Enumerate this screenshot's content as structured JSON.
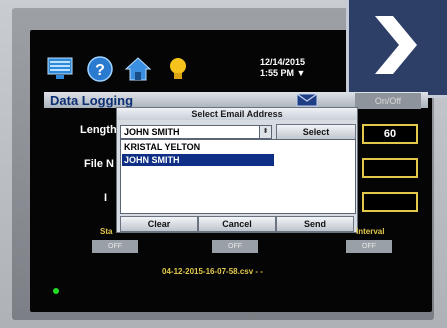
{
  "header": {
    "date": "12/14/2015",
    "time": "1:55 PM ▼"
  },
  "icons": [
    "monitor-icon",
    "help-icon",
    "home-icon",
    "lightbulb-icon",
    "email-icon",
    "chevron-right-icon"
  ],
  "page": {
    "title": "Data Logging",
    "onoff_label": "On/Off"
  },
  "fields": {
    "length_label": "Length (",
    "length_value": "60",
    "file_label": "File N",
    "i_label": "I"
  },
  "dialog": {
    "title": "Select Email Address",
    "combo_value": "JOHN SMITH",
    "select_label": "Select",
    "list": [
      "KRISTAL YELTON",
      "JOHN SMITH"
    ],
    "selected_index": 1,
    "buttons": {
      "clear": "Clear",
      "cancel": "Cancel",
      "send": "Send"
    }
  },
  "bottom": {
    "start_label": "Sta",
    "interval_label": "Interval",
    "toggles": [
      "OFF",
      "OFF",
      "OFF"
    ],
    "filename": "04-12-2015-16-07-58.csv - -"
  },
  "colors": {
    "accent": "#e2c94c",
    "title_blue": "#0c2f73",
    "selection": "#0f2f86",
    "badge": "#2e3f67"
  }
}
